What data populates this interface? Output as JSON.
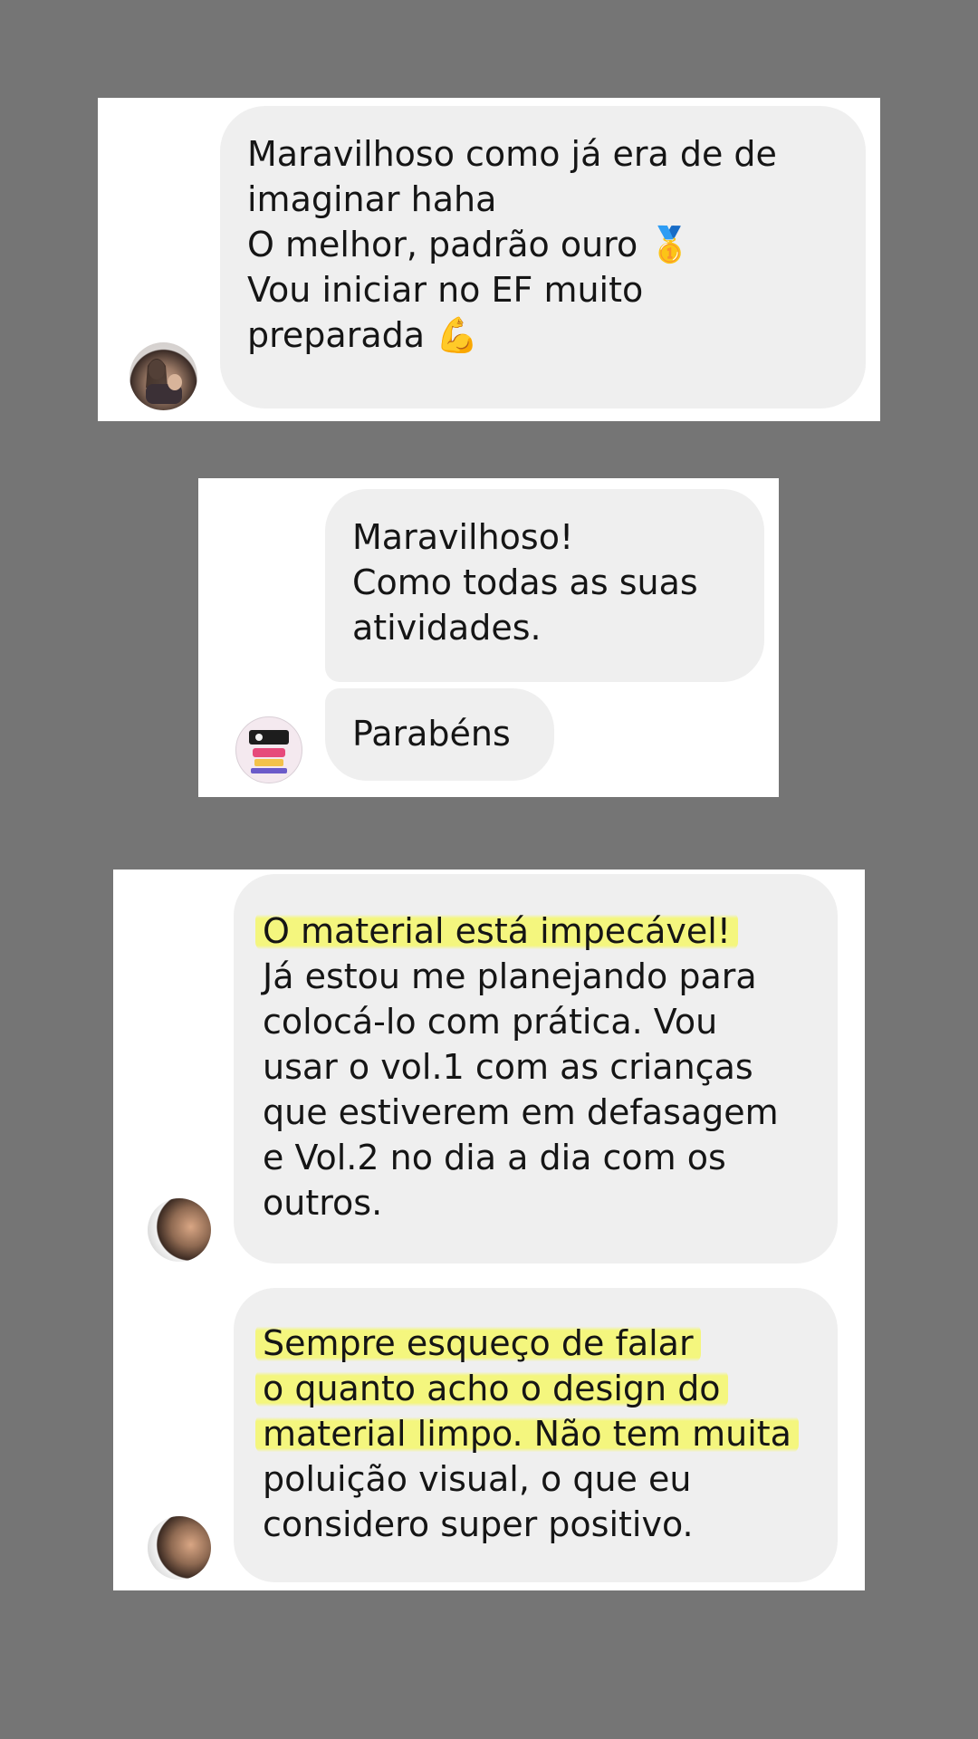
{
  "conversation_1": {
    "bubble": {
      "lines": [
        "Maravilhoso como já era de de",
        "imaginar haha",
        "O melhor, padrão ouro",
        "Vou iniciar no EF muito",
        "preparada"
      ],
      "emoji_medal": "🥇",
      "emoji_muscle": "💪"
    },
    "avatar_icon": "user-photo-avatar"
  },
  "conversation_2": {
    "bubble_1": {
      "lines": [
        "Maravilhoso!",
        "Como todas as suas",
        "atividades."
      ]
    },
    "bubble_2": {
      "lines": [
        "Parabéns"
      ]
    },
    "avatar_icon": "brand-logo-avatar"
  },
  "conversation_3": {
    "bubble_1": {
      "lines": [
        "O material está impecável!",
        "Já estou me planejando para",
        "colocá-lo com prática. Vou",
        "usar o vol.1 com as crianças",
        "que estiverem em defasagem",
        "e Vol.2 no dia a dia com os",
        "outros."
      ]
    },
    "bubble_2": {
      "lines": [
        "Sempre esqueço de falar",
        "o quanto acho o design do",
        "material limpo. Não tem muita",
        "poluição visual, o que eu",
        "considero super positivo."
      ]
    },
    "avatar_icon": "user-photo-avatar"
  },
  "colors": {
    "background": "#757575",
    "card": "#ffffff",
    "bubble": "#efefef",
    "highlight": "#f4f678"
  }
}
